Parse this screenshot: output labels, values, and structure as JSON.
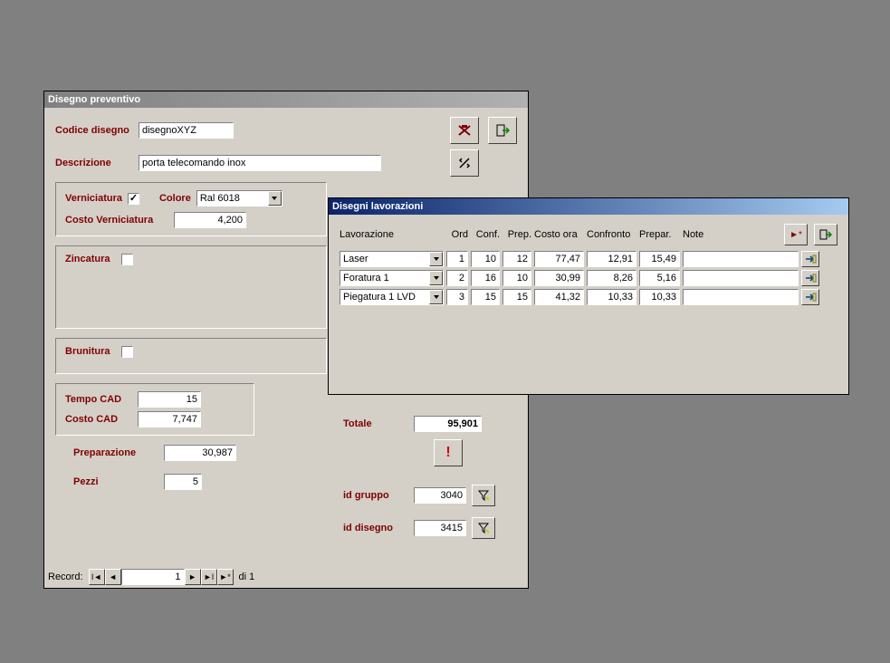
{
  "main_window": {
    "title": "Disegno preventivo",
    "codice_disegno_label": "Codice disegno",
    "codice_disegno_value": "disegnoXYZ",
    "descrizione_label": "Descrizione",
    "descrizione_value": "porta telecomando inox",
    "verniciatura_label": "Verniciatura",
    "verniciatura_checked": true,
    "colore_label": "Colore",
    "colore_value": "Ral 6018",
    "costo_verniciatura_label": "Costo Verniciatura",
    "costo_verniciatura_value": "4,200",
    "zincatura_label": "Zincatura",
    "brunitura_label": "Brunitura",
    "tempo_cad_label": "Tempo CAD",
    "tempo_cad_value": "15",
    "costo_cad_label": "Costo CAD",
    "costo_cad_value": "7,747",
    "preparazione_label": "Preparazione",
    "preparazione_value": "30,987",
    "pezzi_label": "Pezzi",
    "pezzi_value": "5",
    "totale_label": "Totale",
    "totale_value": "95,901",
    "id_gruppo_label": "id gruppo",
    "id_gruppo_value": "3040",
    "id_disegno_label": "id disegno",
    "id_disegno_value": "3415",
    "record_label": "Record:",
    "record_value": "1",
    "record_of": "di 1"
  },
  "sub_window": {
    "title": "Disegni lavorazioni",
    "headers": {
      "lavorazione": "Lavorazione",
      "ord": "Ord",
      "conf": "Conf.",
      "prep": "Prep.",
      "costo_ora": "Costo ora",
      "confronto": "Confronto",
      "prepar": "Prepar.",
      "note": "Note"
    },
    "rows": [
      {
        "lavorazione": "Laser",
        "ord": "1",
        "conf": "10",
        "prep": "12",
        "costo_ora": "77,47",
        "confronto": "12,91",
        "prepar": "15,49",
        "note": ""
      },
      {
        "lavorazione": "Foratura 1",
        "ord": "2",
        "conf": "16",
        "prep": "10",
        "costo_ora": "30,99",
        "confronto": "8,26",
        "prepar": "5,16",
        "note": ""
      },
      {
        "lavorazione": "Piegatura 1 LVD",
        "ord": "3",
        "conf": "15",
        "prep": "15",
        "costo_ora": "41,32",
        "confronto": "10,33",
        "prepar": "10,33",
        "note": ""
      }
    ]
  }
}
